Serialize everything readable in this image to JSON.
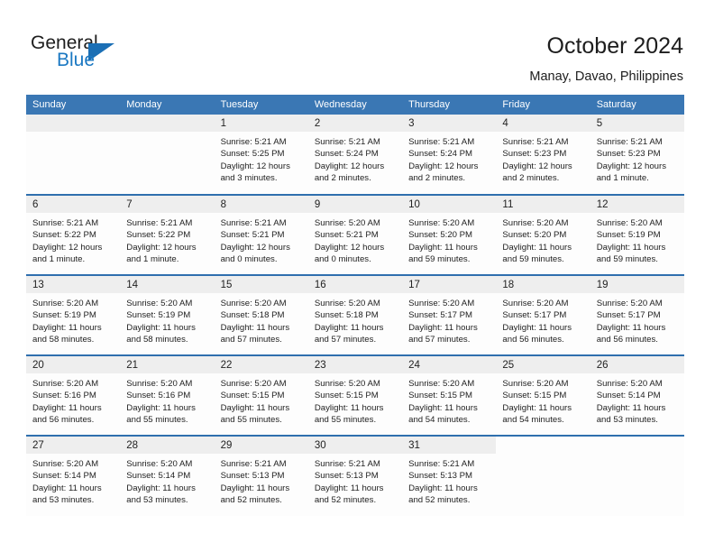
{
  "brand": {
    "name_part1": "General",
    "name_part2": "Blue",
    "triangle_icon": "triangle-icon",
    "accent_color": "#1b78c2"
  },
  "header": {
    "title": "October 2024",
    "location": "Manay, Davao, Philippines",
    "header_bg_color": "#3a77b4",
    "row_divider_color": "#2f6fae",
    "daynum_bg_color": "#eeeeee"
  },
  "weekday_headers": [
    "Sunday",
    "Monday",
    "Tuesday",
    "Wednesday",
    "Thursday",
    "Friday",
    "Saturday"
  ],
  "labels": {
    "sunrise": "Sunrise:",
    "sunset": "Sunset:",
    "daylight": "Daylight:"
  },
  "weeks": [
    [
      {
        "day": "",
        "empty": true
      },
      {
        "day": "",
        "empty": true
      },
      {
        "day": "1",
        "sunrise": "Sunrise: 5:21 AM",
        "sunset": "Sunset: 5:25 PM",
        "daylight_l1": "Daylight: 12 hours",
        "daylight_l2": "and 3 minutes."
      },
      {
        "day": "2",
        "sunrise": "Sunrise: 5:21 AM",
        "sunset": "Sunset: 5:24 PM",
        "daylight_l1": "Daylight: 12 hours",
        "daylight_l2": "and 2 minutes."
      },
      {
        "day": "3",
        "sunrise": "Sunrise: 5:21 AM",
        "sunset": "Sunset: 5:24 PM",
        "daylight_l1": "Daylight: 12 hours",
        "daylight_l2": "and 2 minutes."
      },
      {
        "day": "4",
        "sunrise": "Sunrise: 5:21 AM",
        "sunset": "Sunset: 5:23 PM",
        "daylight_l1": "Daylight: 12 hours",
        "daylight_l2": "and 2 minutes."
      },
      {
        "day": "5",
        "sunrise": "Sunrise: 5:21 AM",
        "sunset": "Sunset: 5:23 PM",
        "daylight_l1": "Daylight: 12 hours",
        "daylight_l2": "and 1 minute."
      }
    ],
    [
      {
        "day": "6",
        "sunrise": "Sunrise: 5:21 AM",
        "sunset": "Sunset: 5:22 PM",
        "daylight_l1": "Daylight: 12 hours",
        "daylight_l2": "and 1 minute."
      },
      {
        "day": "7",
        "sunrise": "Sunrise: 5:21 AM",
        "sunset": "Sunset: 5:22 PM",
        "daylight_l1": "Daylight: 12 hours",
        "daylight_l2": "and 1 minute."
      },
      {
        "day": "8",
        "sunrise": "Sunrise: 5:21 AM",
        "sunset": "Sunset: 5:21 PM",
        "daylight_l1": "Daylight: 12 hours",
        "daylight_l2": "and 0 minutes."
      },
      {
        "day": "9",
        "sunrise": "Sunrise: 5:20 AM",
        "sunset": "Sunset: 5:21 PM",
        "daylight_l1": "Daylight: 12 hours",
        "daylight_l2": "and 0 minutes."
      },
      {
        "day": "10",
        "sunrise": "Sunrise: 5:20 AM",
        "sunset": "Sunset: 5:20 PM",
        "daylight_l1": "Daylight: 11 hours",
        "daylight_l2": "and 59 minutes."
      },
      {
        "day": "11",
        "sunrise": "Sunrise: 5:20 AM",
        "sunset": "Sunset: 5:20 PM",
        "daylight_l1": "Daylight: 11 hours",
        "daylight_l2": "and 59 minutes."
      },
      {
        "day": "12",
        "sunrise": "Sunrise: 5:20 AM",
        "sunset": "Sunset: 5:19 PM",
        "daylight_l1": "Daylight: 11 hours",
        "daylight_l2": "and 59 minutes."
      }
    ],
    [
      {
        "day": "13",
        "sunrise": "Sunrise: 5:20 AM",
        "sunset": "Sunset: 5:19 PM",
        "daylight_l1": "Daylight: 11 hours",
        "daylight_l2": "and 58 minutes."
      },
      {
        "day": "14",
        "sunrise": "Sunrise: 5:20 AM",
        "sunset": "Sunset: 5:19 PM",
        "daylight_l1": "Daylight: 11 hours",
        "daylight_l2": "and 58 minutes."
      },
      {
        "day": "15",
        "sunrise": "Sunrise: 5:20 AM",
        "sunset": "Sunset: 5:18 PM",
        "daylight_l1": "Daylight: 11 hours",
        "daylight_l2": "and 57 minutes."
      },
      {
        "day": "16",
        "sunrise": "Sunrise: 5:20 AM",
        "sunset": "Sunset: 5:18 PM",
        "daylight_l1": "Daylight: 11 hours",
        "daylight_l2": "and 57 minutes."
      },
      {
        "day": "17",
        "sunrise": "Sunrise: 5:20 AM",
        "sunset": "Sunset: 5:17 PM",
        "daylight_l1": "Daylight: 11 hours",
        "daylight_l2": "and 57 minutes."
      },
      {
        "day": "18",
        "sunrise": "Sunrise: 5:20 AM",
        "sunset": "Sunset: 5:17 PM",
        "daylight_l1": "Daylight: 11 hours",
        "daylight_l2": "and 56 minutes."
      },
      {
        "day": "19",
        "sunrise": "Sunrise: 5:20 AM",
        "sunset": "Sunset: 5:17 PM",
        "daylight_l1": "Daylight: 11 hours",
        "daylight_l2": "and 56 minutes."
      }
    ],
    [
      {
        "day": "20",
        "sunrise": "Sunrise: 5:20 AM",
        "sunset": "Sunset: 5:16 PM",
        "daylight_l1": "Daylight: 11 hours",
        "daylight_l2": "and 56 minutes."
      },
      {
        "day": "21",
        "sunrise": "Sunrise: 5:20 AM",
        "sunset": "Sunset: 5:16 PM",
        "daylight_l1": "Daylight: 11 hours",
        "daylight_l2": "and 55 minutes."
      },
      {
        "day": "22",
        "sunrise": "Sunrise: 5:20 AM",
        "sunset": "Sunset: 5:15 PM",
        "daylight_l1": "Daylight: 11 hours",
        "daylight_l2": "and 55 minutes."
      },
      {
        "day": "23",
        "sunrise": "Sunrise: 5:20 AM",
        "sunset": "Sunset: 5:15 PM",
        "daylight_l1": "Daylight: 11 hours",
        "daylight_l2": "and 55 minutes."
      },
      {
        "day": "24",
        "sunrise": "Sunrise: 5:20 AM",
        "sunset": "Sunset: 5:15 PM",
        "daylight_l1": "Daylight: 11 hours",
        "daylight_l2": "and 54 minutes."
      },
      {
        "day": "25",
        "sunrise": "Sunrise: 5:20 AM",
        "sunset": "Sunset: 5:15 PM",
        "daylight_l1": "Daylight: 11 hours",
        "daylight_l2": "and 54 minutes."
      },
      {
        "day": "26",
        "sunrise": "Sunrise: 5:20 AM",
        "sunset": "Sunset: 5:14 PM",
        "daylight_l1": "Daylight: 11 hours",
        "daylight_l2": "and 53 minutes."
      }
    ],
    [
      {
        "day": "27",
        "sunrise": "Sunrise: 5:20 AM",
        "sunset": "Sunset: 5:14 PM",
        "daylight_l1": "Daylight: 11 hours",
        "daylight_l2": "and 53 minutes."
      },
      {
        "day": "28",
        "sunrise": "Sunrise: 5:20 AM",
        "sunset": "Sunset: 5:14 PM",
        "daylight_l1": "Daylight: 11 hours",
        "daylight_l2": "and 53 minutes."
      },
      {
        "day": "29",
        "sunrise": "Sunrise: 5:21 AM",
        "sunset": "Sunset: 5:13 PM",
        "daylight_l1": "Daylight: 11 hours",
        "daylight_l2": "and 52 minutes."
      },
      {
        "day": "30",
        "sunrise": "Sunrise: 5:21 AM",
        "sunset": "Sunset: 5:13 PM",
        "daylight_l1": "Daylight: 11 hours",
        "daylight_l2": "and 52 minutes."
      },
      {
        "day": "31",
        "sunrise": "Sunrise: 5:21 AM",
        "sunset": "Sunset: 5:13 PM",
        "daylight_l1": "Daylight: 11 hours",
        "daylight_l2": "and 52 minutes."
      },
      {
        "day": "",
        "empty": true,
        "blank": true
      },
      {
        "day": "",
        "empty": true,
        "blank": true
      }
    ]
  ]
}
